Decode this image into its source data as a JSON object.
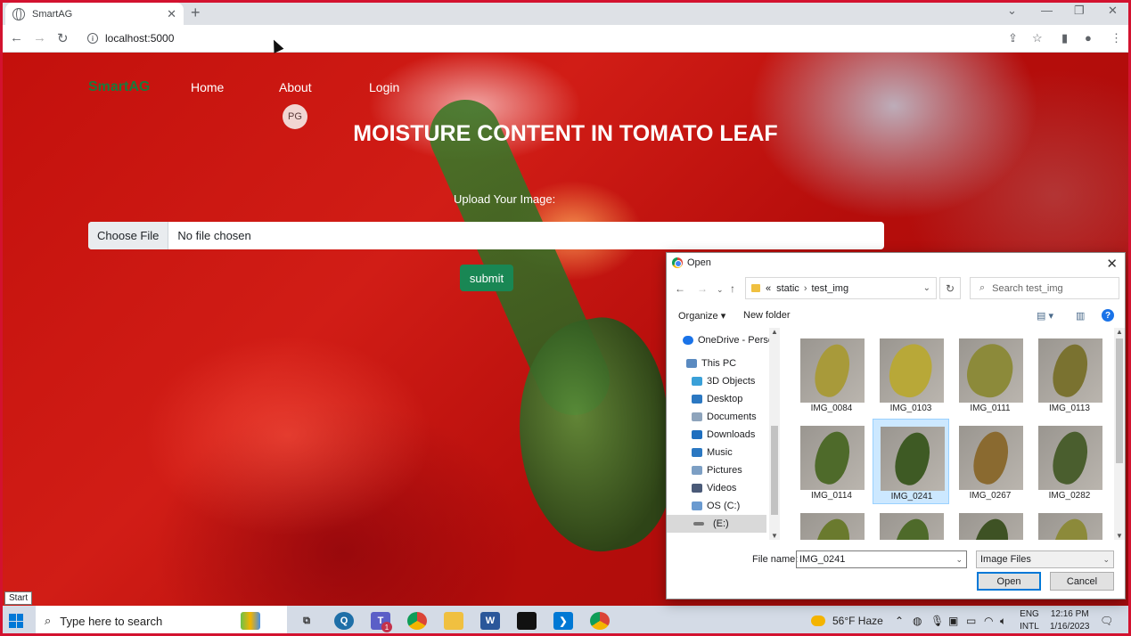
{
  "browser": {
    "tab_title": "SmartAG",
    "url": "localhost:5000",
    "profile_initials": "PG"
  },
  "site": {
    "brand": "SmartAG",
    "nav": [
      "Home",
      "About",
      "Login"
    ],
    "headline": "MOISTURE CONTENT IN TOMATO LEAF",
    "upload_label": "Upload Your Image:",
    "choose_file": "Choose File",
    "no_file": "No file chosen",
    "submit": "submit"
  },
  "dialog": {
    "title": "Open",
    "path": [
      "static",
      "test_img"
    ],
    "path_prefix": "«",
    "search_placeholder": "Search test_img",
    "organize": "Organize",
    "new_folder": "New folder",
    "nav_items": [
      {
        "label": "OneDrive - Person",
        "icon": "cloud-icon"
      },
      {
        "label": "This PC",
        "icon": "computer-icon"
      },
      {
        "label": "3D Objects",
        "icon": "cube-icon"
      },
      {
        "label": "Desktop",
        "icon": "desktop-icon"
      },
      {
        "label": "Documents",
        "icon": "documents-icon"
      },
      {
        "label": "Downloads",
        "icon": "download-icon"
      },
      {
        "label": "Music",
        "icon": "music-icon"
      },
      {
        "label": "Pictures",
        "icon": "pictures-icon"
      },
      {
        "label": "Videos",
        "icon": "videos-icon"
      },
      {
        "label": "OS (C:)",
        "icon": "drive-icon"
      },
      {
        "label": "(E:)",
        "icon": "usb-drive-icon"
      }
    ],
    "files": [
      "IMG_0084",
      "IMG_0103",
      "IMG_0111",
      "IMG_0113",
      "IMG_0114",
      "IMG_0241",
      "IMG_0267",
      "IMG_0282"
    ],
    "selected_file": "IMG_0241",
    "filename_label": "File name:",
    "filename_value": "IMG_0241",
    "filetype": "Image Files",
    "open_button": "Open",
    "cancel_button": "Cancel"
  },
  "tooltip": "Start",
  "taskbar": {
    "search_placeholder": "Type here to search",
    "weather": "56°F  Haze",
    "lang_top": "ENG",
    "lang_bottom": "INTL",
    "time": "12:16 PM",
    "date": "1/16/2023",
    "teams_badge": "1"
  },
  "colors": {
    "brand_green": "#1a7a3c",
    "submit_green": "#198754",
    "frame_red": "#d3122f",
    "selection_blue": "#cce8ff"
  }
}
